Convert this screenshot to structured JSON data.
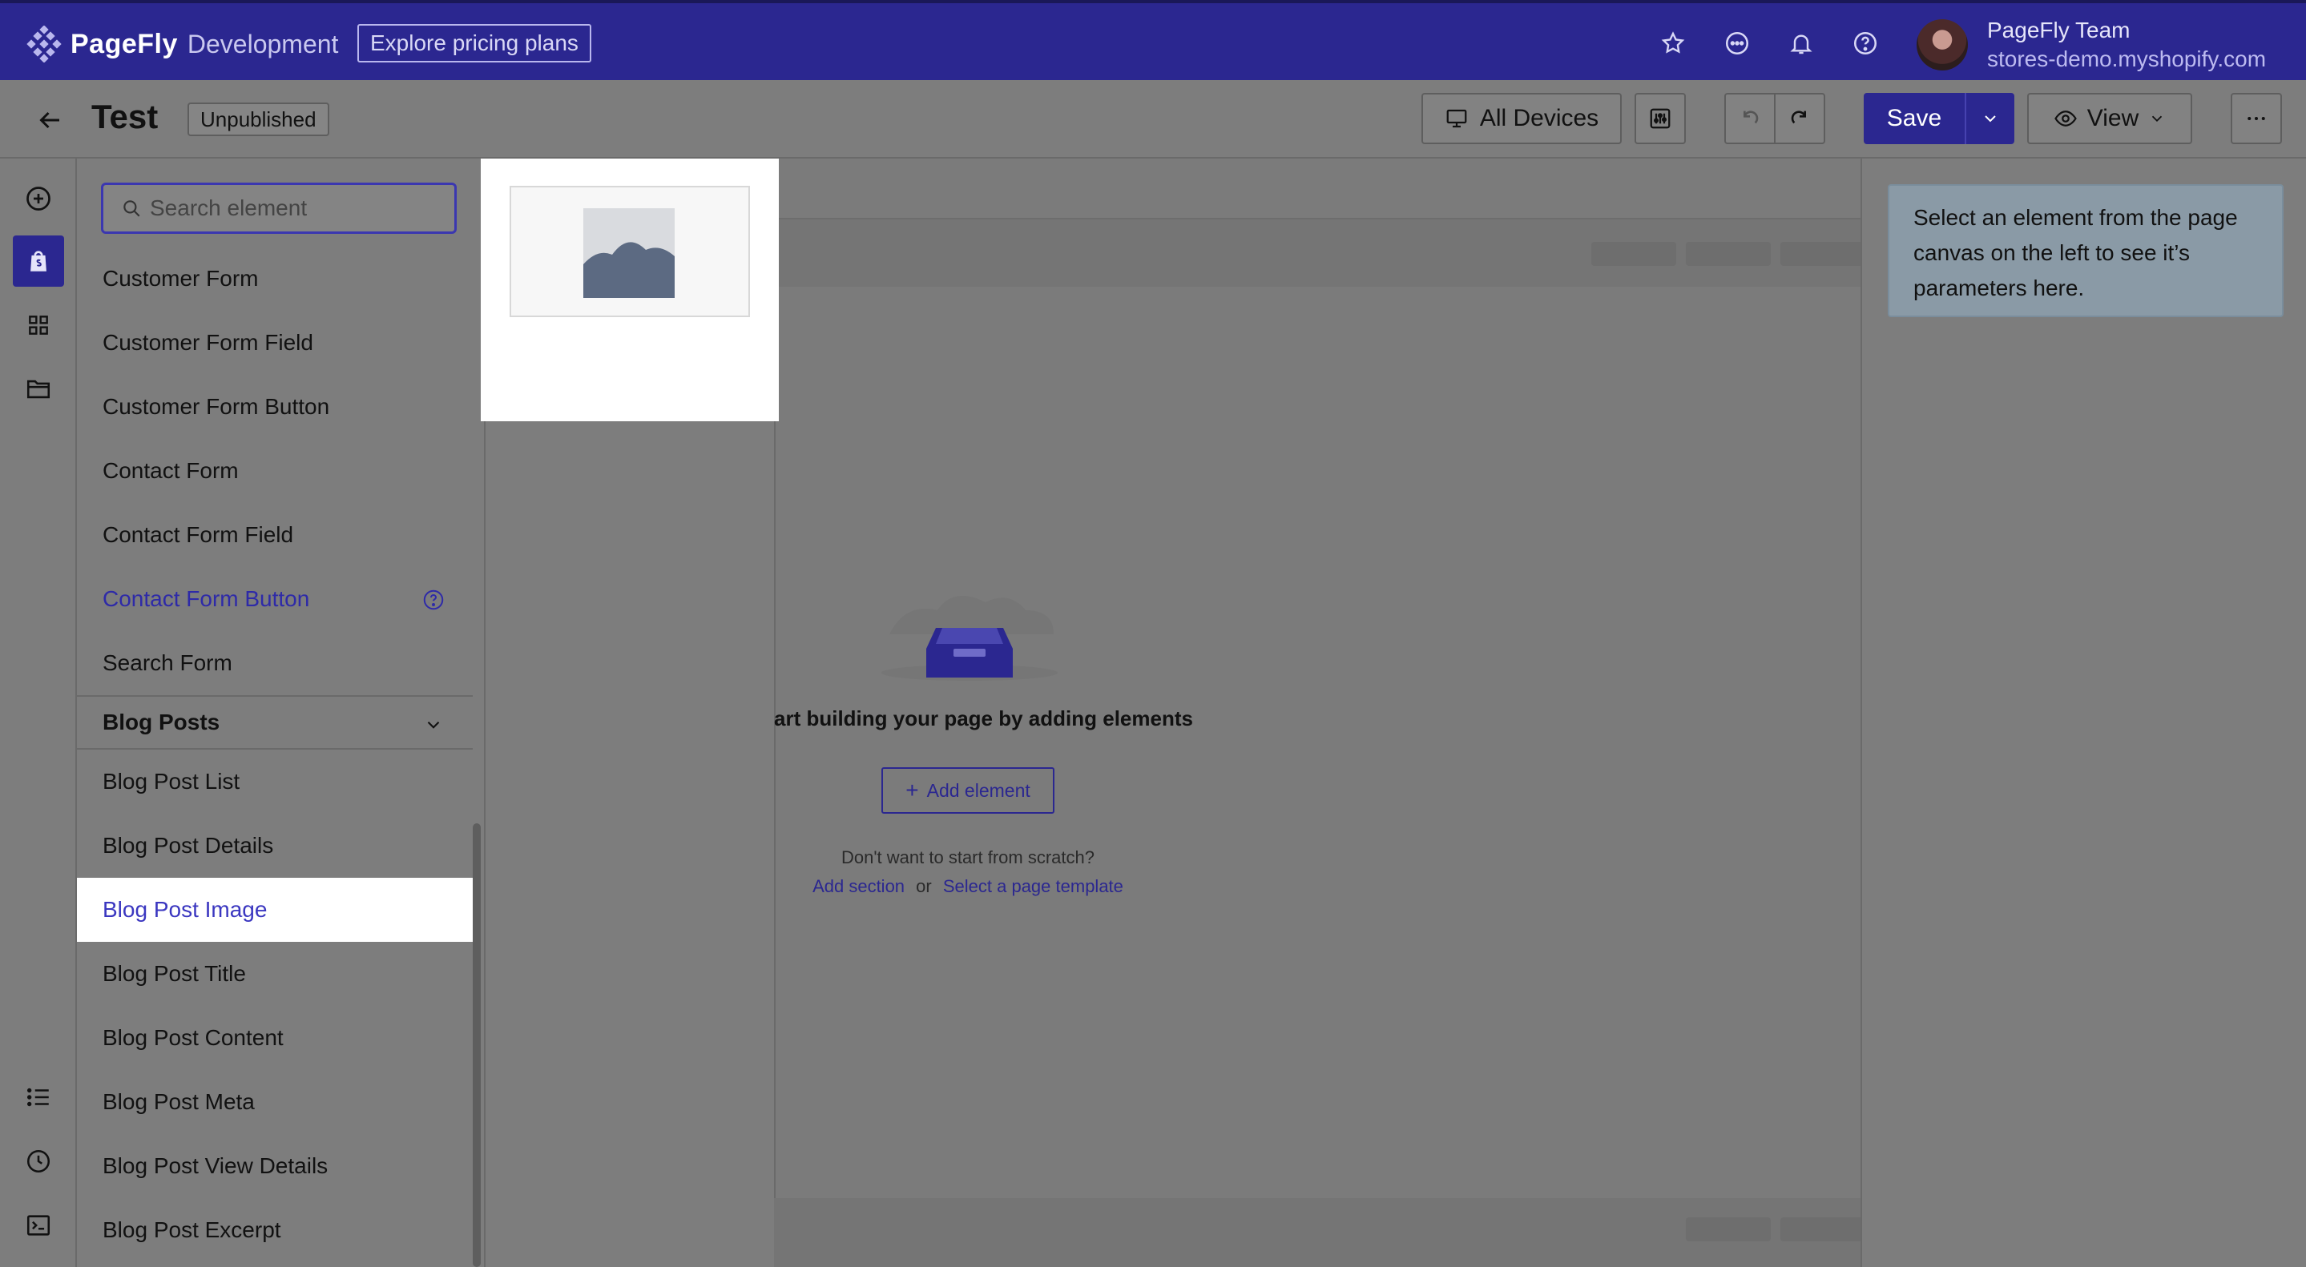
{
  "topbar": {
    "brand": "PageFly",
    "brand_suffix": "Development",
    "pricing_label": "Explore pricing plans",
    "team_name": "PageFly Team",
    "store": "stores-demo.myshopify.com",
    "icons": [
      "star-icon",
      "chat-icon",
      "bell-icon",
      "help-icon"
    ]
  },
  "subbar": {
    "title": "Test",
    "status": "Unpublished",
    "devices_label": "All Devices",
    "save_label": "Save",
    "view_label": "View"
  },
  "search": {
    "placeholder": "Search element"
  },
  "elements": {
    "form_items": [
      {
        "label": "Customer Form"
      },
      {
        "label": "Customer Form Field"
      },
      {
        "label": "Customer Form Button"
      },
      {
        "label": "Contact Form"
      },
      {
        "label": "Contact Form Field"
      },
      {
        "label": "Contact Form Button"
      },
      {
        "label": "Search Form"
      }
    ],
    "group_blog": "Blog Posts",
    "blog_items": [
      {
        "label": "Blog Post List"
      },
      {
        "label": "Blog Post Details"
      },
      {
        "label": "Blog Post Image"
      },
      {
        "label": "Blog Post Title"
      },
      {
        "label": "Blog Post Content"
      },
      {
        "label": "Blog Post Meta"
      },
      {
        "label": "Blog Post View Details"
      },
      {
        "label": "Blog Post Excerpt"
      }
    ]
  },
  "canvas": {
    "empty_title": "art building your page by adding elements",
    "add_element_label": "Add element",
    "scratch_text": "Don't want to start from scratch?",
    "add_section_label": "Add section",
    "or_text": "or",
    "template_label": "Select a page template"
  },
  "params": {
    "hint": "Select an element from the page canvas on the left to see it’s parameters here."
  },
  "colors": {
    "brand": "#2b2790",
    "selected_text": "#3b37c0"
  }
}
